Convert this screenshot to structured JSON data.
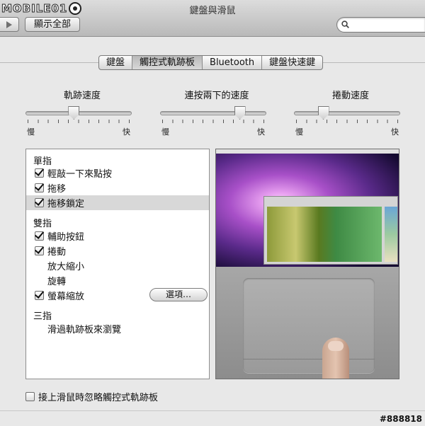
{
  "window": {
    "title": "鍵盤與滑鼠",
    "logo_text": "MOBILE01",
    "show_all_label": "顯示全部",
    "search_placeholder": ""
  },
  "tabs": [
    {
      "label": "鍵盤",
      "active": false
    },
    {
      "label": "觸控式軌跡板",
      "active": true
    },
    {
      "label": "Bluetooth",
      "active": false
    },
    {
      "label": "鍵盤快速鍵",
      "active": false
    }
  ],
  "sliders": [
    {
      "label": "軌跡速度",
      "min_label": "慢",
      "max_label": "快",
      "value": 0.45
    },
    {
      "label": "連按兩下的速度",
      "min_label": "慢",
      "max_label": "快",
      "value": 0.78
    },
    {
      "label": "捲動速度",
      "min_label": "慢",
      "max_label": "快",
      "value": 0.25
    }
  ],
  "gestures": {
    "one_finger": {
      "title": "單指",
      "items": [
        {
          "label": "輕敲一下來點按",
          "checked": true
        },
        {
          "label": "拖移",
          "checked": true
        },
        {
          "label": "拖移鎖定",
          "checked": true,
          "selected": true
        }
      ]
    },
    "two_fingers": {
      "title": "雙指",
      "items": [
        {
          "label": "輔助按鈕",
          "checked": true
        },
        {
          "label": "捲動",
          "checked": true
        },
        {
          "label": "放大縮小",
          "checkbox": false
        },
        {
          "label": "旋轉",
          "checkbox": false
        },
        {
          "label": "螢幕縮放",
          "checked": true
        }
      ],
      "options_label": "選項…"
    },
    "three_fingers": {
      "title": "三指",
      "items": [
        {
          "label": "滑過軌跡板來瀏覽",
          "checkbox": false
        }
      ]
    }
  },
  "ignore_trackpad": {
    "label": "接上滑鼠時忽略觸控式軌跡板",
    "checked": false
  },
  "watermark": "#888818",
  "colors": {
    "window_bg": "#e8e8e8",
    "toolbar_top": "#dcdcdc",
    "selected_row": "#d8d8d8"
  }
}
